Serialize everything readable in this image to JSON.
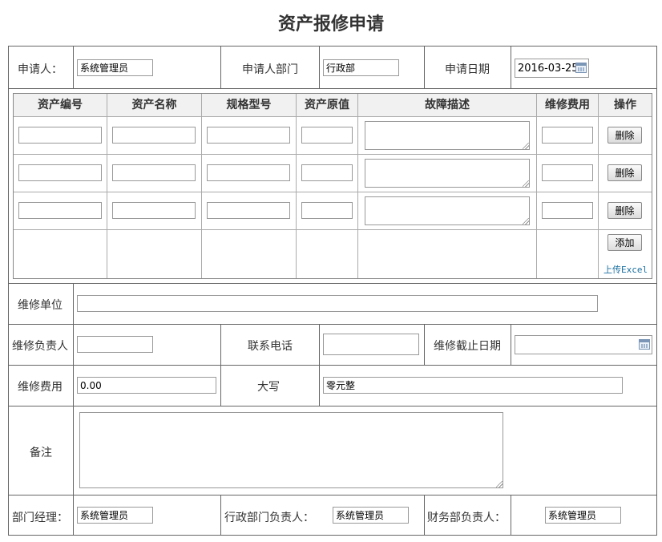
{
  "title": "资产报修申请",
  "header": {
    "applicant_label": "申请人：",
    "applicant_value": "系统管理员",
    "department_label": "申请人部门",
    "department_value": "行政部",
    "date_label": "申请日期",
    "date_value": "2016-03-25"
  },
  "asset_table": {
    "columns": [
      "资产编号",
      "资产名称",
      "规格型号",
      "资产原值",
      "故障描述",
      "维修费用",
      "操作"
    ],
    "rows": [
      {
        "asset_no": "",
        "asset_name": "",
        "spec": "",
        "original_value": "",
        "fault": "",
        "cost": "",
        "action": "删除"
      },
      {
        "asset_no": "",
        "asset_name": "",
        "spec": "",
        "original_value": "",
        "fault": "",
        "cost": "",
        "action": "删除"
      },
      {
        "asset_no": "",
        "asset_name": "",
        "spec": "",
        "original_value": "",
        "fault": "",
        "cost": "",
        "action": "删除"
      }
    ],
    "add_label": "添加",
    "upload_label": "上传Excel"
  },
  "repair": {
    "unit_label": "维修单位",
    "unit_value": "",
    "manager_label": "维修负责人",
    "manager_value": "",
    "phone_label": "联系电话",
    "phone_value": "",
    "deadline_label": "维修截止日期",
    "deadline_value": "",
    "cost_label": "维修费用",
    "cost_value": "0.00",
    "uppercase_label": "大写",
    "uppercase_value": "零元整",
    "remark_label": "备注",
    "remark_value": ""
  },
  "approvals": {
    "dept_manager_label": "部门经理：",
    "dept_manager_value": "系统管理员",
    "admin_head_label": "行政部门负责人：",
    "admin_head_value": "系统管理员",
    "finance_head_label": "财务部负责人：",
    "finance_head_value": "系统管理员"
  }
}
